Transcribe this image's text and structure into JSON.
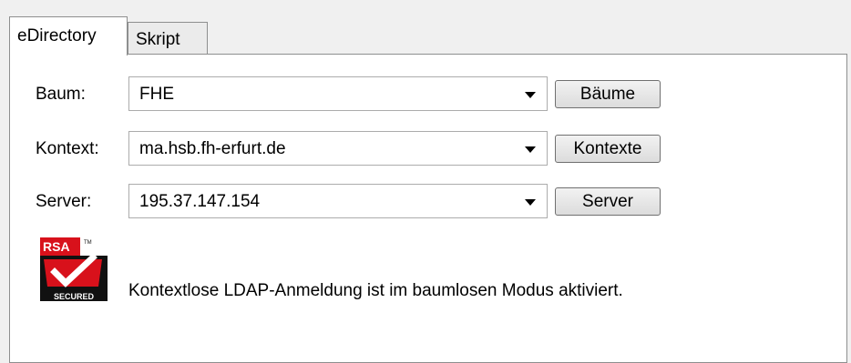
{
  "tabs": [
    {
      "label": "eDirectory",
      "active": true
    },
    {
      "label": "Skript",
      "active": false
    }
  ],
  "fields": {
    "tree": {
      "label": "Baum:",
      "value": "FHE",
      "button": "Bäume"
    },
    "context": {
      "label": "Kontext:",
      "value": "ma.hsb.fh-erfurt.de",
      "button": "Kontexte"
    },
    "server": {
      "label": "Server:",
      "value": "195.37.147.154",
      "button": "Server"
    }
  },
  "logo": {
    "brand": "RSA",
    "tm": "TM",
    "caption": "SECURED"
  },
  "info_text": "Kontextlose LDAP-Anmeldung ist im baumlosen Modus aktiviert.",
  "colors": {
    "logo_red": "#d8111b",
    "logo_black": "#111111",
    "panel_border": "#8e8f8f"
  }
}
